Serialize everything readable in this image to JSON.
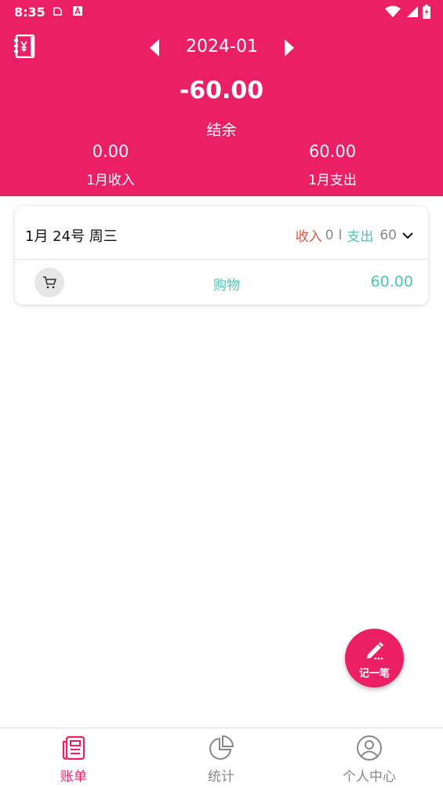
{
  "status_bar": {
    "time": "8:35",
    "icons": [
      "clipboard-icon",
      "a-badge-icon",
      "wifi-icon",
      "signal-icon",
      "battery-charging-icon"
    ]
  },
  "header": {
    "month": "2024-01",
    "balance": "-60.00",
    "balance_label": "结余",
    "income_value": "0.00",
    "income_label": "1月收入",
    "expense_value": "60.00",
    "expense_label": "1月支出"
  },
  "day_group": {
    "date": "1月 24号 周三",
    "income_label": "收入",
    "income_value": "0",
    "separator": "l",
    "expense_label": "支出",
    "expense_value": "60",
    "entries": [
      {
        "category": "购物",
        "amount": "60.00",
        "icon": "shopping-cart-icon"
      }
    ]
  },
  "fab": {
    "label": "记一笔",
    "icon": "pencil-icon"
  },
  "bottom_nav": [
    {
      "label": "账单",
      "icon": "bill-icon",
      "active": true
    },
    {
      "label": "统计",
      "icon": "pie-chart-icon",
      "active": false
    },
    {
      "label": "个人中心",
      "icon": "user-icon",
      "active": false
    }
  ],
  "colors": {
    "primary": "#eb1f63",
    "income": "#e2543e",
    "expense": "#4ec6b0",
    "muted": "#888888"
  }
}
